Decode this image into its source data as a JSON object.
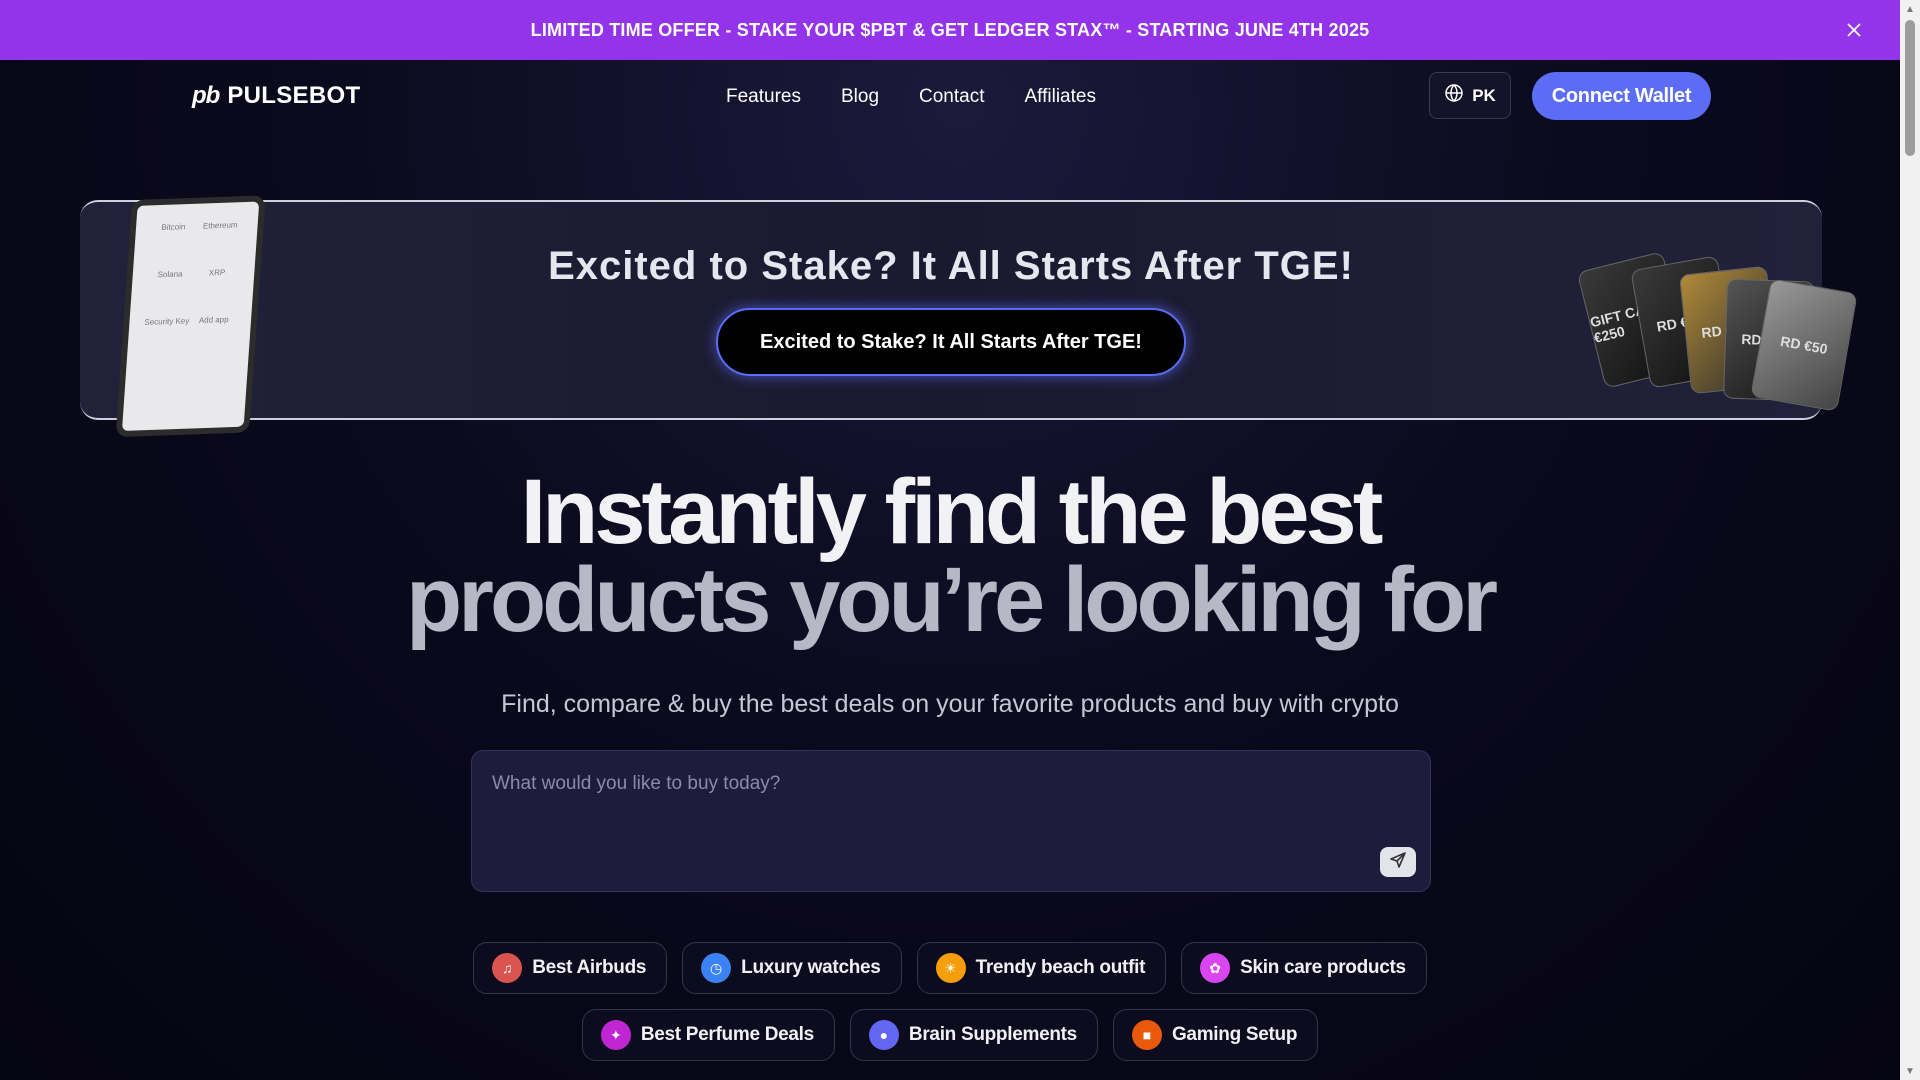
{
  "promo": {
    "text": "LIMITED TIME OFFER - STAKE YOUR $PBT & GET LEDGER STAX™ - STARTING JUNE 4TH 2025"
  },
  "nav": {
    "logo_mark": "pb",
    "logo_text": "PULSEBOT",
    "links": [
      "Features",
      "Blog",
      "Contact",
      "Affiliates"
    ],
    "language": "PK",
    "connect_label": "Connect Wallet"
  },
  "stake": {
    "title": "Excited to Stake? It All Starts After TGE!",
    "button_label": "Excited to Stake? It All Starts After TGE!",
    "device_labels": [
      "Bitcoin",
      "Ethereum",
      "Solana",
      "XRP",
      "Security Key",
      "Add app"
    ],
    "card_labels": [
      "GIFT CARD €250",
      "RD €200",
      "RD €150",
      "RD €100",
      "RD €50"
    ]
  },
  "hero": {
    "line1": "Instantly find the best",
    "line2": "products you’re looking for",
    "subtitle": "Find, compare & buy the best deals on your favorite products and buy with crypto"
  },
  "search": {
    "placeholder": "What would you like to buy today?"
  },
  "chips": [
    {
      "label": "Best Airbuds",
      "icon": "headphones-icon",
      "color": "#d9534f"
    },
    {
      "label": "Luxury watches",
      "icon": "watch-icon",
      "color": "#3b82f6"
    },
    {
      "label": "Trendy beach outfit",
      "icon": "beach-icon",
      "color": "#f59e0b"
    },
    {
      "label": "Skin care products",
      "icon": "skincare-icon",
      "color": "#d946ef"
    },
    {
      "label": "Best Perfume Deals",
      "icon": "perfume-icon",
      "color": "#c026d3"
    },
    {
      "label": "Brain Supplements",
      "icon": "brain-icon",
      "color": "#6366f1"
    },
    {
      "label": "Gaming Setup",
      "icon": "gamepad-icon",
      "color": "#ea580c"
    }
  ]
}
